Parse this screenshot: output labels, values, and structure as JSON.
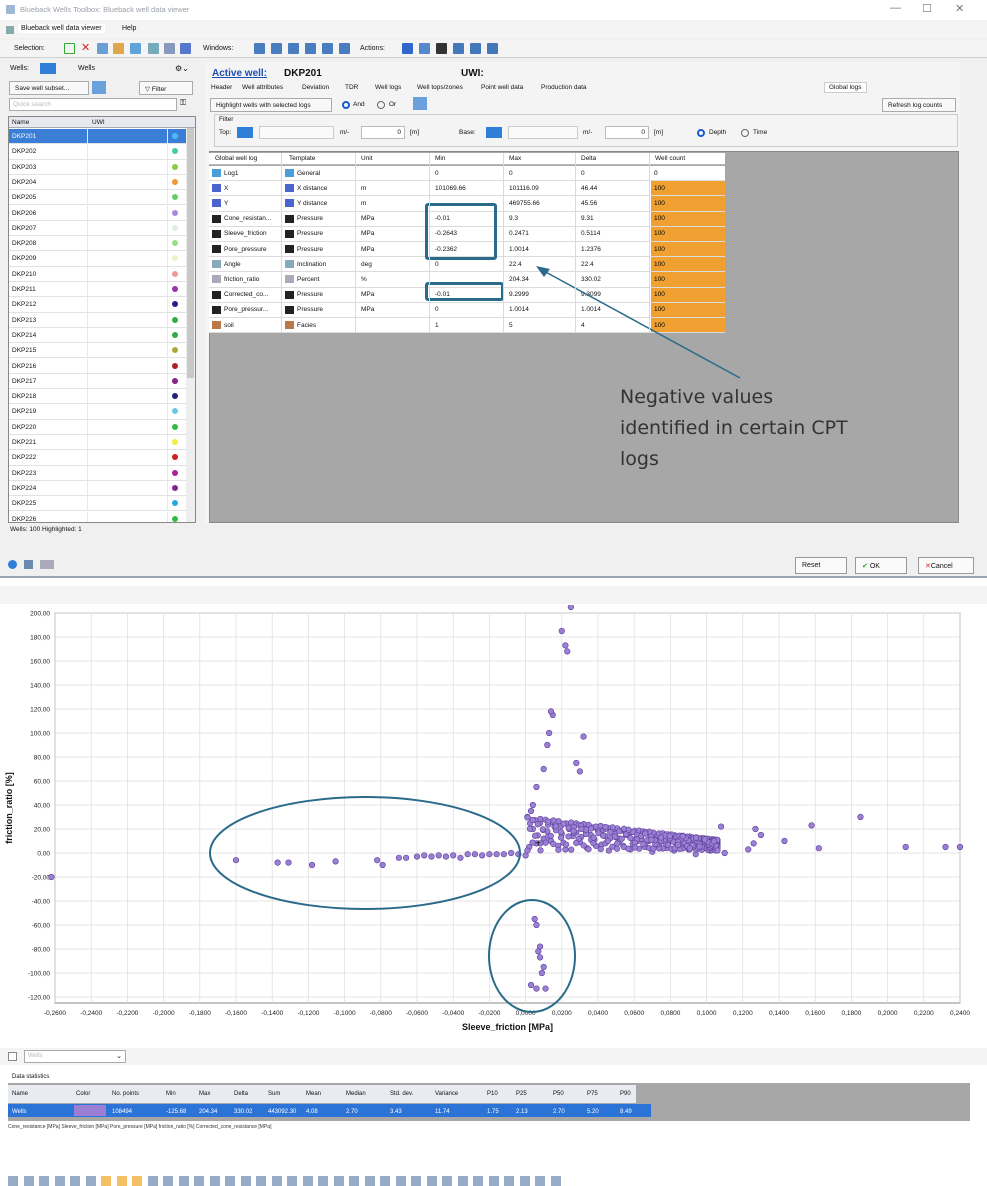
{
  "window": {
    "title": "Blueback Wells Toolbox: Blueback well data viewer",
    "tab": "Blueback well data viewer",
    "menu_help": "Help"
  },
  "toolbar": {
    "selection_label": "Selection:",
    "windows_label": "Windows:",
    "actions_label": "Actions:"
  },
  "left": {
    "wells_label": "Wells:",
    "wells_value": "Wells",
    "save_subset": "Save well subset...",
    "filter": "Filter",
    "quick_search": "Quick search",
    "col_name": "Name",
    "col_uwi": "UWI",
    "footer": "Wells: 100  Highlighted: 1",
    "wells": [
      {
        "name": "DKP201",
        "color": "#4db8ff"
      },
      {
        "name": "DKP202",
        "color": "#44ccaa"
      },
      {
        "name": "DKP203",
        "color": "#88cc44"
      },
      {
        "name": "DKP204",
        "color": "#ee9933"
      },
      {
        "name": "DKP205",
        "color": "#66cc66"
      },
      {
        "name": "DKP206",
        "color": "#aa88dd"
      },
      {
        "name": "DKP207",
        "color": "#ddeedd"
      },
      {
        "name": "DKP208",
        "color": "#99dd88"
      },
      {
        "name": "DKP209",
        "color": "#f0f0c0"
      },
      {
        "name": "DKP210",
        "color": "#ee9999"
      },
      {
        "name": "DKP211",
        "color": "#9933aa"
      },
      {
        "name": "DKP212",
        "color": "#222288"
      },
      {
        "name": "DKP213",
        "color": "#33aa44"
      },
      {
        "name": "DKP214",
        "color": "#33aa44"
      },
      {
        "name": "DKP215",
        "color": "#aaaa33"
      },
      {
        "name": "DKP216",
        "color": "#aa2222"
      },
      {
        "name": "DKP217",
        "color": "#882288"
      },
      {
        "name": "DKP218",
        "color": "#222277"
      },
      {
        "name": "DKP219",
        "color": "#66ccdd"
      },
      {
        "name": "DKP220",
        "color": "#33bb44"
      },
      {
        "name": "DKP221",
        "color": "#eeee44"
      },
      {
        "name": "DKP222",
        "color": "#cc2222"
      },
      {
        "name": "DKP223",
        "color": "#aa2299"
      },
      {
        "name": "DKP224",
        "color": "#882299"
      },
      {
        "name": "DKP225",
        "color": "#22aadd"
      },
      {
        "name": "DKP226",
        "color": "#33bb44"
      }
    ]
  },
  "right": {
    "active_well_label": "Active well:",
    "active_well": "DKP201",
    "uwi_label": "UWI:",
    "tabs": [
      "Header",
      "Well attributes",
      "Deviation",
      "TDR",
      "Well logs",
      "Well tops/zones",
      "Point well data",
      "Production data"
    ],
    "global_logs_tab": "Global logs",
    "highlight_btn": "Highlight wells with selected logs",
    "and_label": "And",
    "or_label": "Or",
    "refresh_btn": "Refresh log counts",
    "filter_label": "Filter",
    "top_label": "Top:",
    "base_label": "Base:",
    "top_value": "0",
    "base_value": "0",
    "unit_m": "[m]",
    "depth_label": "Depth",
    "time_label": "Time",
    "columns": [
      "Global well log",
      "Template",
      "Unit",
      "Min",
      "Max",
      "Delta",
      "Well count"
    ],
    "rows": [
      {
        "log": "Log1",
        "template": "General",
        "unit": "",
        "min": "0",
        "max": "0",
        "delta": "0",
        "count": "0"
      },
      {
        "log": "X",
        "template": "X distance",
        "unit": "m",
        "min": "101069.66",
        "max": "101116.09",
        "delta": "46.44",
        "count": "100"
      },
      {
        "log": "Y",
        "template": "Y distance",
        "unit": "m",
        "min": "",
        "max": "469755.66",
        "delta": "45.56",
        "count": "100"
      },
      {
        "log": "Cone_resistan...",
        "template": "Pressure",
        "unit": "MPa",
        "min": "-0.01",
        "max": "9.3",
        "delta": "9.31",
        "count": "100"
      },
      {
        "log": "Sleeve_friction",
        "template": "Pressure",
        "unit": "MPa",
        "min": "-0.2643",
        "max": "0.2471",
        "delta": "0.5114",
        "count": "100"
      },
      {
        "log": "Pore_pressure",
        "template": "Pressure",
        "unit": "MPa",
        "min": "-0.2362",
        "max": "1.0014",
        "delta": "1.2376",
        "count": "100"
      },
      {
        "log": "Angle",
        "template": "Inclination",
        "unit": "deg",
        "min": "0",
        "max": "22.4",
        "delta": "22.4",
        "count": "100"
      },
      {
        "log": "friction_ratio",
        "template": "Percent",
        "unit": "%",
        "min": "",
        "max": "204.34",
        "delta": "330.02",
        "count": "100"
      },
      {
        "log": "Corrected_co...",
        "template": "Pressure",
        "unit": "MPa",
        "min": "-0.01",
        "max": "9.2999",
        "delta": "9.3099",
        "count": "100"
      },
      {
        "log": "Pore_pressur...",
        "template": "Pressure",
        "unit": "MPa",
        "min": "0",
        "max": "1.0014",
        "delta": "1.0014",
        "count": "100"
      },
      {
        "log": "soil",
        "template": "Facies",
        "unit": "",
        "min": "1",
        "max": "5",
        "delta": "4",
        "count": "100"
      }
    ],
    "annotation": "Negative values identified in certain CPT logs"
  },
  "buttons": {
    "reset": "Reset",
    "ok": "OK",
    "cancel": "Cancel"
  },
  "chart": {
    "legend_filter": "Wells",
    "stats_title": "Data statistics",
    "stats_columns": [
      "Name",
      "Color",
      "No. points",
      "Min",
      "Max",
      "Delta",
      "Sum",
      "Mean",
      "Median",
      "Std. dev.",
      "Variance",
      "P10",
      "P25",
      "P50",
      "P75",
      "P90"
    ],
    "stats_row": [
      "Wells",
      "",
      "108494",
      "-125.68",
      "204.34",
      "330.02",
      "443092.30",
      "4.08",
      "2.70",
      "3.43",
      "11.74",
      "1.75",
      "2.13",
      "2.70",
      "5.20",
      "8.49"
    ],
    "footer_tabs": "Cone_resistance [MPa]   Sleeve_friction [MPa]   Pore_pressure [MPa]   friction_ratio [%]   Corrected_cone_resistance [MPa]"
  },
  "chart_data": {
    "type": "scatter",
    "xlabel": "Sleeve_friction [MPa]",
    "ylabel": "friction_ratio [%]",
    "xlim": [
      -0.26,
      0.24
    ],
    "ylim": [
      -125,
      200
    ],
    "x_ticks": [
      "-0,2600",
      "-0,2400",
      "-0,2200",
      "-0,2000",
      "-0,1800",
      "-0,1600",
      "-0,1400",
      "-0,1200",
      "-0,1000",
      "-0,0800",
      "-0,0600",
      "-0,0400",
      "-0,0200",
      "0,0000",
      "0,0200",
      "0,0400",
      "0,0600",
      "0,0800",
      "0,1000",
      "0,1200",
      "0,1400",
      "0,1600",
      "0,1800",
      "0,2000",
      "0,2200",
      "0,2400"
    ],
    "y_ticks": [
      "200,00",
      "180,00",
      "160,00",
      "140,00",
      "120,00",
      "100,00",
      "80,00",
      "60,00",
      "40,00",
      "20,00",
      "0,00",
      "-20,00",
      "-40,00",
      "-60,00",
      "-80,00",
      "-100,00",
      "-120,00"
    ],
    "point_color": "#9b7fd4",
    "series": [
      {
        "values": [
          [
            -0.262,
            -20
          ],
          [
            -0.16,
            -6
          ],
          [
            -0.137,
            -8
          ],
          [
            -0.131,
            -8
          ],
          [
            -0.118,
            -10
          ],
          [
            -0.105,
            -7
          ],
          [
            -0.082,
            -6
          ],
          [
            -0.079,
            -10
          ],
          [
            -0.07,
            -4
          ],
          [
            -0.066,
            -4
          ],
          [
            -0.06,
            -3
          ],
          [
            -0.056,
            -2
          ],
          [
            -0.052,
            -3
          ],
          [
            -0.048,
            -2
          ],
          [
            -0.044,
            -3
          ],
          [
            -0.04,
            -2
          ],
          [
            -0.036,
            -4
          ],
          [
            -0.032,
            -1
          ],
          [
            -0.028,
            -1
          ],
          [
            -0.024,
            -2
          ],
          [
            -0.02,
            -1
          ],
          [
            -0.016,
            -1
          ],
          [
            -0.012,
            -1
          ],
          [
            -0.008,
            0
          ],
          [
            -0.004,
            -1
          ],
          [
            0.005,
            -55
          ],
          [
            0.006,
            -60
          ],
          [
            0.008,
            -78
          ],
          [
            0.007,
            -82
          ],
          [
            0.01,
            -95
          ],
          [
            0.009,
            -100
          ],
          [
            0.003,
            -110
          ],
          [
            0.006,
            -113
          ],
          [
            0.011,
            -113
          ],
          [
            0.008,
            -87
          ],
          [
            0.004,
            40
          ],
          [
            0.006,
            55
          ],
          [
            0.01,
            70
          ],
          [
            0.012,
            90
          ],
          [
            0.013,
            100
          ],
          [
            0.015,
            115
          ],
          [
            0.014,
            118
          ],
          [
            0.02,
            185
          ],
          [
            0.022,
            173
          ],
          [
            0.025,
            205
          ],
          [
            0.023,
            168
          ],
          [
            0.032,
            97
          ],
          [
            0.028,
            75
          ],
          [
            0.03,
            68
          ],
          [
            0.002,
            5
          ],
          [
            0.006,
            8
          ],
          [
            0.01,
            12
          ],
          [
            0.014,
            10
          ],
          [
            0.018,
            6
          ],
          [
            0.022,
            3
          ],
          [
            0.026,
            14
          ],
          [
            0.03,
            9
          ],
          [
            0.034,
            4
          ],
          [
            0.038,
            11
          ],
          [
            0.042,
            7
          ],
          [
            0.046,
            2
          ],
          [
            0.05,
            13
          ],
          [
            0.054,
            6
          ],
          [
            0.058,
            3
          ],
          [
            0.062,
            10
          ],
          [
            0.066,
            5
          ],
          [
            0.07,
            1
          ],
          [
            0.074,
            8
          ],
          [
            0.078,
            4
          ],
          [
            0.082,
            2
          ],
          [
            0.086,
            7
          ],
          [
            0.09,
            3
          ],
          [
            0.094,
            -1
          ],
          [
            0.098,
            4
          ],
          [
            0.102,
            2
          ],
          [
            0.106,
            6
          ],
          [
            0.11,
            0
          ],
          [
            0.004,
            20
          ],
          [
            0.008,
            25
          ],
          [
            0.012,
            18
          ],
          [
            0.016,
            22
          ],
          [
            0.02,
            16
          ],
          [
            0.024,
            20
          ],
          [
            0.028,
            17
          ],
          [
            0.032,
            23
          ],
          [
            0.036,
            15
          ],
          [
            0.04,
            19
          ],
          [
            0.044,
            14
          ],
          [
            0.048,
            18
          ],
          [
            0.052,
            12
          ],
          [
            0.056,
            16
          ],
          [
            0.06,
            11
          ],
          [
            0.064,
            15
          ],
          [
            0.068,
            10
          ],
          [
            0.072,
            14
          ],
          [
            0.108,
            22
          ],
          [
            0.127,
            20
          ],
          [
            0.13,
            15
          ],
          [
            0.126,
            8
          ],
          [
            0.123,
            3
          ],
          [
            0.143,
            10
          ],
          [
            0.158,
            23
          ],
          [
            0.162,
            4
          ],
          [
            0.185,
            30
          ],
          [
            0.21,
            5
          ],
          [
            0.232,
            5
          ],
          [
            0.24,
            5
          ],
          [
            0.001,
            30
          ],
          [
            0.003,
            35
          ],
          [
            0.0,
            -2
          ]
        ]
      }
    ]
  }
}
